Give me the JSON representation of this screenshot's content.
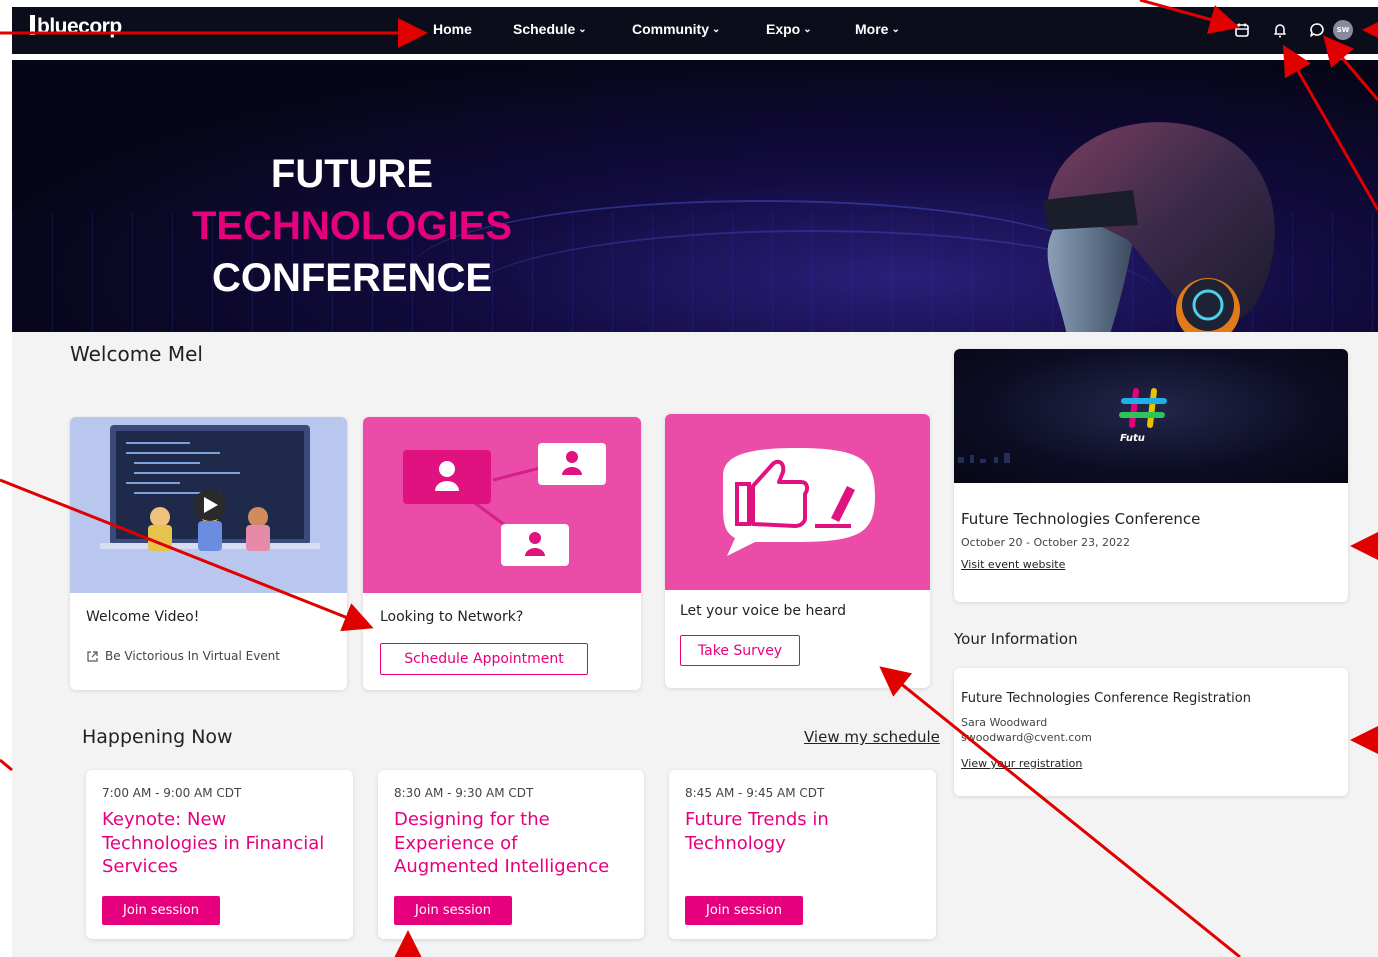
{
  "brand": {
    "logo_text": "bluecorp",
    "accent": "#e6007e",
    "nav_bg": "#0b0d1a"
  },
  "nav": {
    "items": [
      {
        "label": "Home"
      },
      {
        "label": "Schedule",
        "chevron": "chevron-down-icon"
      },
      {
        "label": "Community",
        "chevron": "chevron-down-icon"
      },
      {
        "label": "Expo",
        "chevron": "chevron-down-icon"
      },
      {
        "label": "More",
        "chevron": "chevron-down-icon"
      }
    ],
    "icons": [
      "calendar-icon",
      "bell-icon",
      "chat-icon"
    ],
    "avatar_initials": "SW"
  },
  "hero": {
    "title_line1_white": "FUTURE",
    "title_line1_accent": "TECHNOLOGIES",
    "title_line2": "CONFERENCE"
  },
  "welcome": "Welcome Mel",
  "cards": [
    {
      "title": "Welcome Video!",
      "link": "Be Victorious In Virtual Event",
      "icon": "play-icon"
    },
    {
      "title": "Looking to Network?",
      "button": "Schedule Appointment"
    },
    {
      "title": "Let your voice be heard",
      "button": "Take Survey"
    }
  ],
  "happening": {
    "title": "Happening Now",
    "view_schedule": "View my schedule",
    "sessions": [
      {
        "time": "7:00 AM - 9:00 AM CDT",
        "title": "Keynote: New Technologies in Financial Services",
        "button": "Join session"
      },
      {
        "time": "8:30 AM - 9:30 AM CDT",
        "title": "Designing for the Experience of Augmented Intelligence",
        "button": "Join session"
      },
      {
        "time": "8:45 AM - 9:45 AM CDT",
        "title": "Future Trends in Technology",
        "button": "Join session"
      }
    ]
  },
  "event": {
    "banner_text": "Futu",
    "name": "Future Technologies Conference",
    "dates": "October 20 - October 23, 2022",
    "website_link": "Visit event website"
  },
  "your_info": {
    "heading": "Your Information",
    "registration_title": "Future Technologies Conference Registration",
    "person_name": "Sara Woodward",
    "email": "swoodward@cvent.com",
    "link": "View your registration"
  }
}
